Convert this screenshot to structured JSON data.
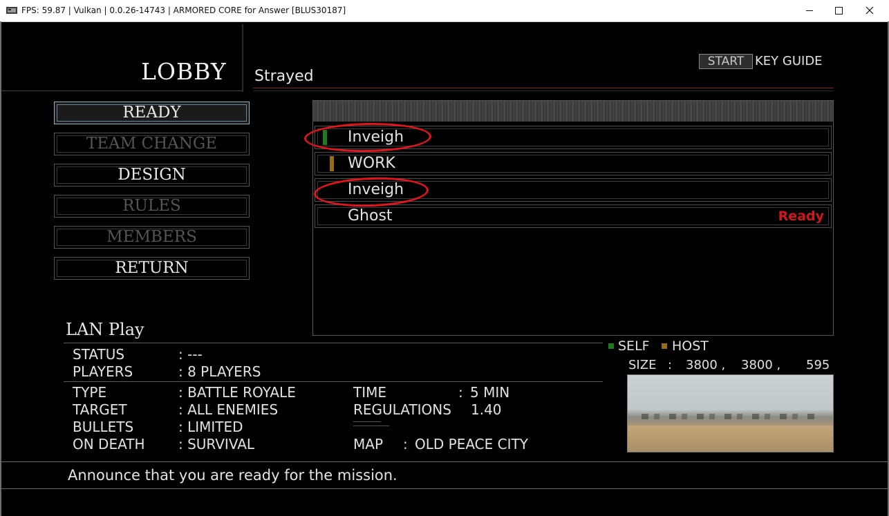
{
  "window": {
    "title": "FPS: 59.87 | Vulkan | 0.0.26-14743 | ARMORED CORE for Answer [BLUS30187]",
    "controls": [
      "minimize",
      "maximize",
      "close"
    ]
  },
  "header": {
    "screen_title": "LOBBY",
    "room_name": "Strayed",
    "start_badge": "START",
    "key_guide": "KEY GUIDE"
  },
  "menu": {
    "items": [
      {
        "label": "READY",
        "state": "selected"
      },
      {
        "label": "TEAM CHANGE",
        "state": "disabled"
      },
      {
        "label": "DESIGN",
        "state": "enabled"
      },
      {
        "label": "RULES",
        "state": "disabled"
      },
      {
        "label": "MEMBERS",
        "state": "disabled"
      },
      {
        "label": "RETURN",
        "state": "enabled"
      }
    ]
  },
  "players": [
    {
      "name": "Inveigh",
      "marker": "self",
      "status": ""
    },
    {
      "name": "WORK",
      "marker": "host",
      "status": ""
    },
    {
      "name": "Inveigh",
      "marker": "",
      "status": ""
    },
    {
      "name": "Ghost",
      "marker": "",
      "status": "Ready"
    }
  ],
  "colors": {
    "self": "#1e7a1e",
    "host": "#9a6a14",
    "ready": "#d01818",
    "annotation": "#e3151a",
    "selected_border": "#8fb4c4"
  },
  "info": {
    "mode_title": "LAN Play",
    "status_label": "STATUS",
    "status_value": ": ---",
    "players_label": "PLAYERS",
    "players_value": ": 8 PLAYERS",
    "type_label": "TYPE",
    "type_value": ": BATTLE ROYALE",
    "target_label": "TARGET",
    "target_value": ": ALL ENEMIES",
    "bullets_label": "BULLETS",
    "bullets_value": ": LIMITED",
    "death_label": "ON DEATH",
    "death_value": ": SURVIVAL",
    "time_label": "TIME",
    "time_colon": ":",
    "time_value": "5 MIN",
    "regulations_label": "REGULATIONS",
    "regulations_value": "1.40",
    "map_label": "MAP",
    "map_colon": ":",
    "map_value": "OLD PEACE CITY"
  },
  "legend": {
    "self": "SELF",
    "host": "HOST"
  },
  "map_size": {
    "label": "SIZE",
    "colon": ":",
    "x": "3800 ,",
    "y": "3800 ,",
    "z": "595"
  },
  "footer": {
    "message": "Announce that you are ready for the mission."
  }
}
